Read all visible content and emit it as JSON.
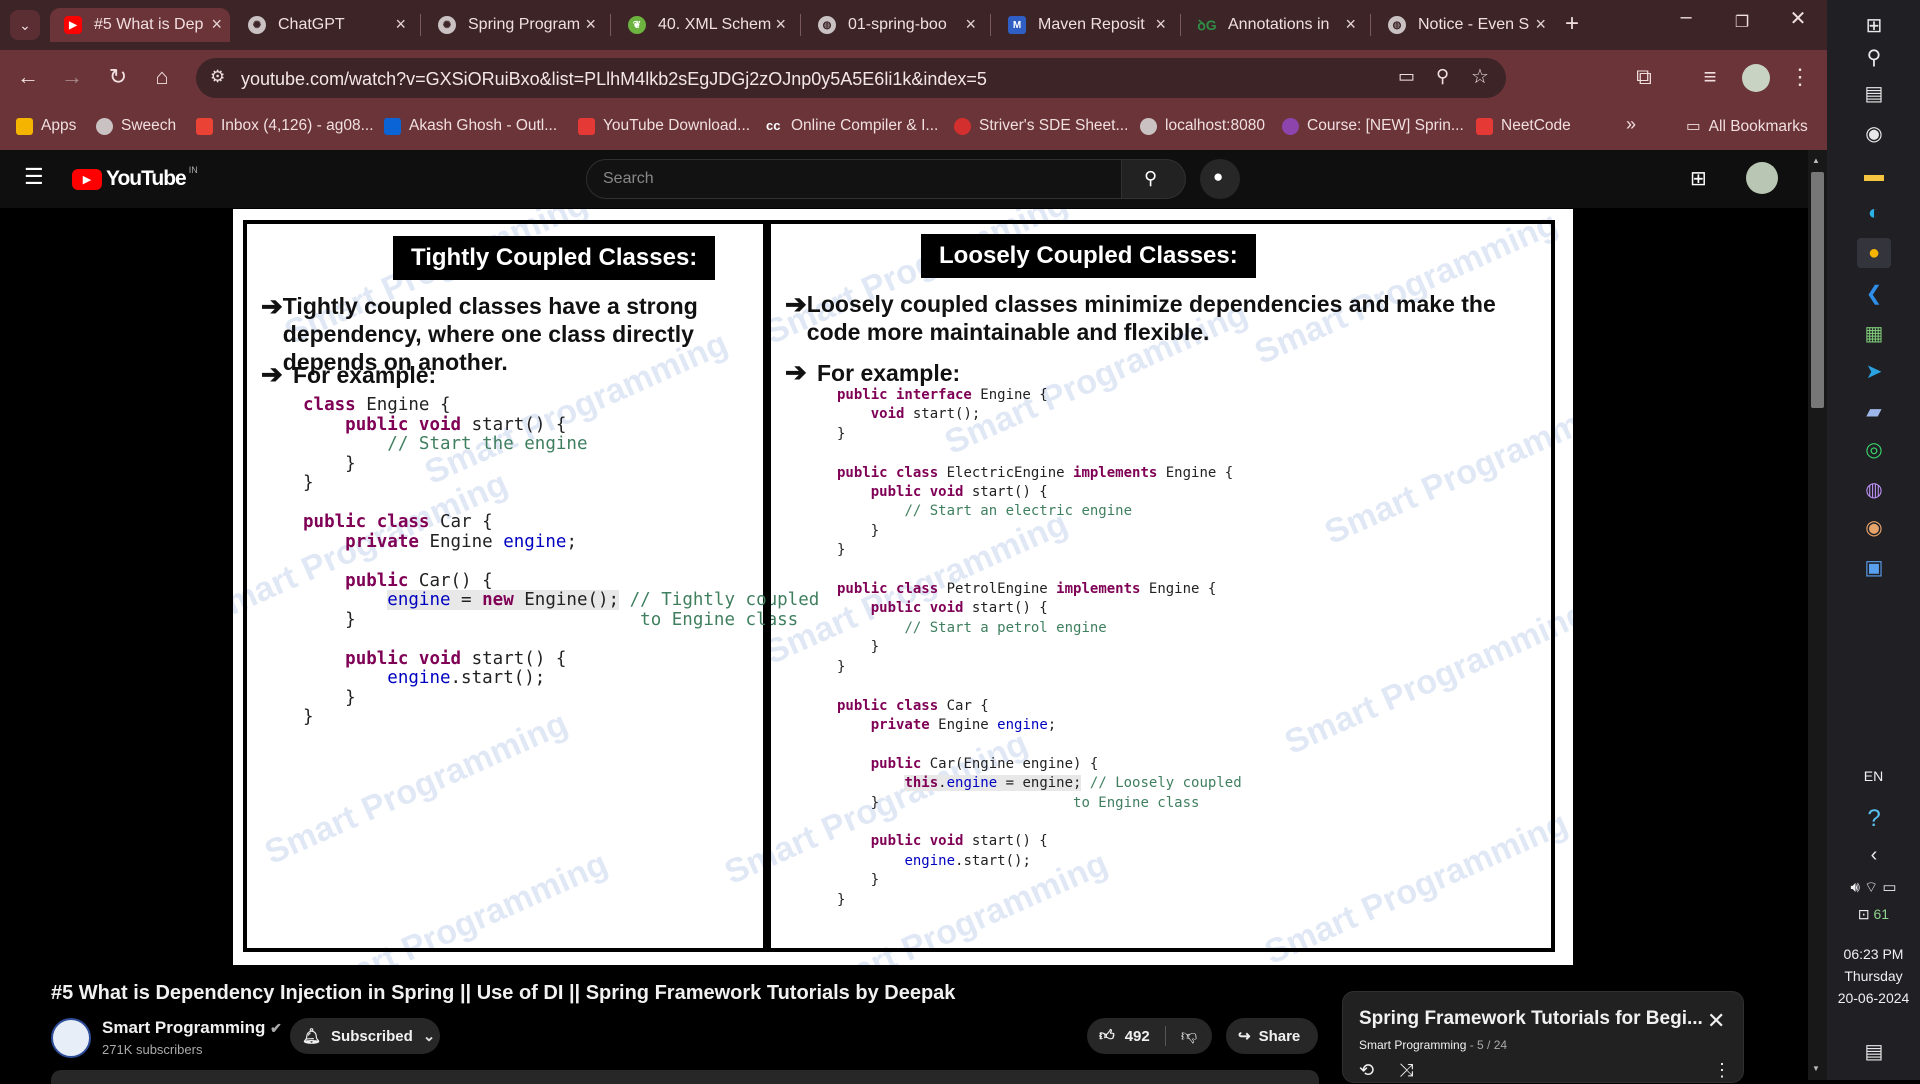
{
  "browser": {
    "tabs": [
      {
        "title": "#5 What is Dep",
        "icon": "youtube-favicon",
        "active": true
      },
      {
        "title": "ChatGPT",
        "icon": "chatgpt-favicon"
      },
      {
        "title": "Spring Program",
        "icon": "chatgpt-favicon"
      },
      {
        "title": "40. XML Schem",
        "icon": "spring-favicon"
      },
      {
        "title": "01-spring-boo",
        "icon": "globe-favicon"
      },
      {
        "title": "Maven Reposit",
        "icon": "maven-favicon"
      },
      {
        "title": "Annotations in",
        "icon": "gfg-favicon"
      },
      {
        "title": "Notice - Even S",
        "icon": "globe-favicon"
      }
    ],
    "new_tab": "+",
    "url": "youtube.com/watch?v=GXSiORuiBxo&list=PLlhM4lkb2sEgJDGj2zOJnp0y5A5E6li1k&index=5",
    "bookmarks": [
      {
        "label": "Apps",
        "color": "#f4b400"
      },
      {
        "label": "Sweech",
        "color": "#c9c1c2"
      },
      {
        "label": "Inbox (4,126) - ag08...",
        "color": "#ea4335"
      },
      {
        "label": "Akash Ghosh - Outl...",
        "color": "#0a64d6"
      },
      {
        "label": "YouTube Download...",
        "color": "#e53935"
      },
      {
        "label": "Online Compiler & I...",
        "color": "#ffffff"
      },
      {
        "label": "Striver's SDE Sheet...",
        "color": "#d32f2f"
      },
      {
        "label": "localhost:8080",
        "color": "#c9c1c2"
      },
      {
        "label": "Course: [NEW] Sprin...",
        "color": "#8e44ad"
      },
      {
        "label": "NeetCode",
        "color": "#e53935"
      }
    ],
    "more_bookmarks": "»",
    "all_bookmarks": "All Bookmarks"
  },
  "youtube": {
    "logo_text": "YouTube",
    "region": "IN",
    "search_placeholder": "Search",
    "video_title": "#5 What is Dependency Injection in Spring || Use of DI || Spring Framework Tutorials by Deepak",
    "channel_name": "Smart Programming",
    "subscribers": "271K subscribers",
    "subscribe_label": "Subscribed",
    "likes": "492",
    "share_label": "Share",
    "playlist_title": "Spring Framework Tutorials for Begi...",
    "playlist_channel": "Smart Programming",
    "playlist_position": "- 5 / 24"
  },
  "slide": {
    "watermark": "Smart Programming",
    "left": {
      "heading": "Tightly Coupled Classes:",
      "point1": "Tightly coupled classes have a strong dependency, where one class directly depends on another.",
      "point2": "For example:"
    },
    "right": {
      "heading": "Loosely Coupled Classes:",
      "point1": "Loosely coupled classes minimize dependencies and make the code more maintainable and flexible.",
      "point2": "For example:"
    }
  },
  "taskbar": {
    "language": "EN",
    "battery": "61",
    "time": "06:23 PM",
    "day": "Thursday",
    "date": "20-06-2024"
  }
}
